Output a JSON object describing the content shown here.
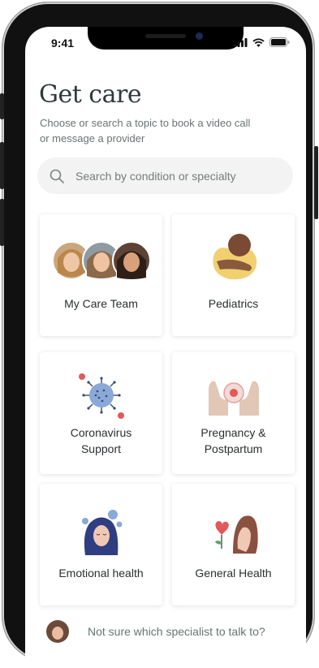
{
  "status": {
    "time": "9:41"
  },
  "header": {
    "title": "Get care",
    "subtitle": "Choose or search a topic to book a video call or message a provider"
  },
  "search": {
    "placeholder": "Search by condition or specialty",
    "value": ""
  },
  "cards": [
    {
      "label": "My Care Team",
      "icon": "care-team-avatars"
    },
    {
      "label": "Pediatrics",
      "icon": "baby-icon"
    },
    {
      "label_lines": [
        "Coronavirus",
        "Support"
      ],
      "icon": "virus-icon"
    },
    {
      "label_lines": [
        "Pregnancy &",
        "Postpartum"
      ],
      "icon": "pregnancy-hands-icon"
    },
    {
      "label": "Emotional health",
      "icon": "emotional-health-icon"
    },
    {
      "label": "General Health",
      "icon": "general-health-icon"
    }
  ],
  "footer": {
    "prompt": "Not sure which specialist to talk to?"
  },
  "colors": {
    "title": "#2d3a3a",
    "subtitle": "#6a7373",
    "search_bg": "#f3f3f3",
    "accent_red": "#e05a5a",
    "accent_blue": "#8aa8d8"
  }
}
